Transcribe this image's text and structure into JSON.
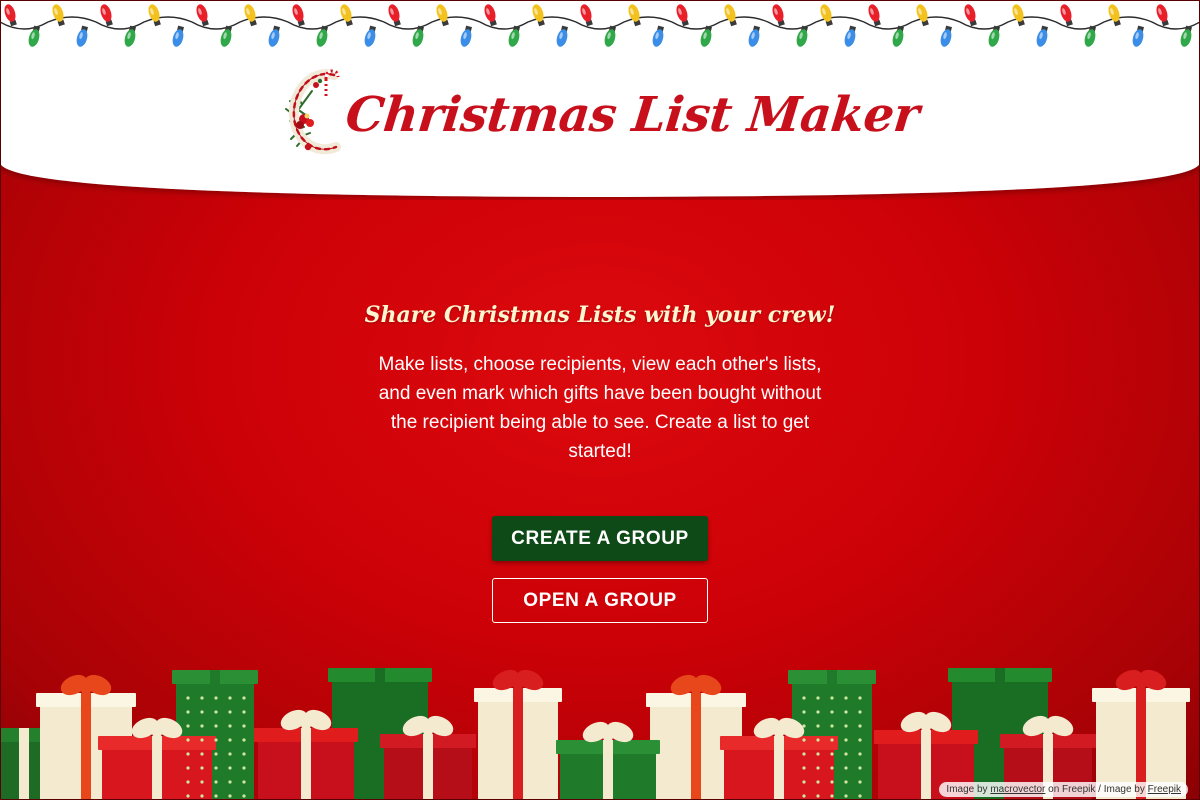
{
  "app": {
    "title": "Christmas List Maker"
  },
  "main": {
    "tagline": "Share Christmas Lists with your crew!",
    "description": "Make lists, choose recipients, view each other's lists, and even mark which gifts have been bought without the recipient being able to see. Create a list to get started!"
  },
  "actions": {
    "create_label": "CREATE A GROUP",
    "open_label": "OPEN A GROUP"
  },
  "credit": {
    "prefix": "Image by",
    "author_link": "macrovector",
    "middle": "on Freepik / Image by",
    "freepik_link": "Freepik"
  },
  "colors": {
    "background_red": "#cc0107",
    "title_red": "#c8101c",
    "primary_button_green": "#0e4a17",
    "tagline_cream": "#fff6d0",
    "header_white": "#ffffff"
  },
  "icons": {
    "header_decoration": "string-lights-icon",
    "title_monogram": "holly-monogram-c-icon",
    "footer_decoration": "gift-boxes-illustration"
  }
}
